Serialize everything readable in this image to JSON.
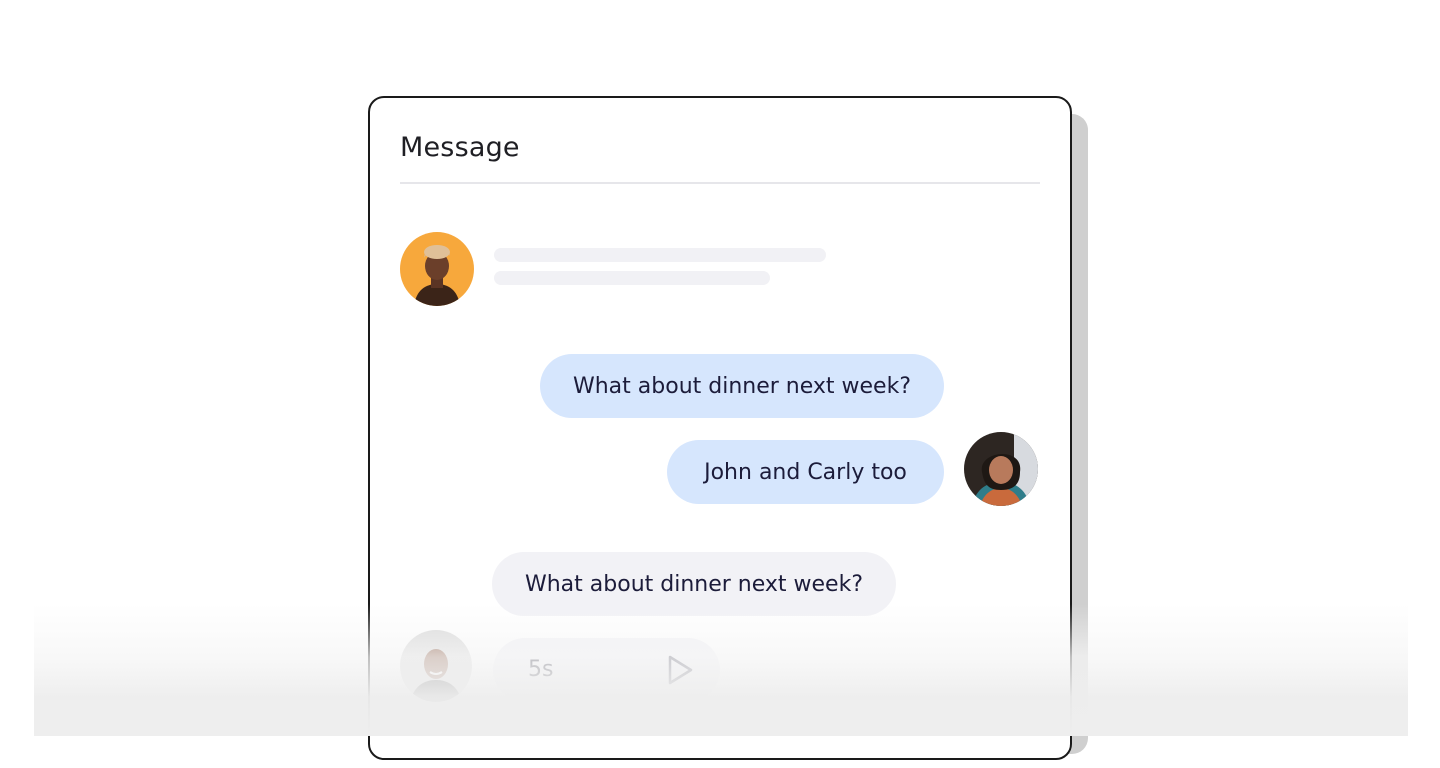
{
  "header": {
    "title": "Message"
  },
  "conversation": {
    "messages": [
      {
        "text": "What about dinner next week?"
      },
      {
        "text": "John and Carly too"
      },
      {
        "text": "What about dinner next week?"
      }
    ],
    "voice_note": {
      "duration": "5s",
      "icon": "play-icon"
    }
  },
  "colors": {
    "sent_bubble": "#d6e6fd",
    "received_bubble": "#f2f2f6",
    "avatar_orange": "#f7a83c",
    "divider": "#e6e6ea"
  }
}
